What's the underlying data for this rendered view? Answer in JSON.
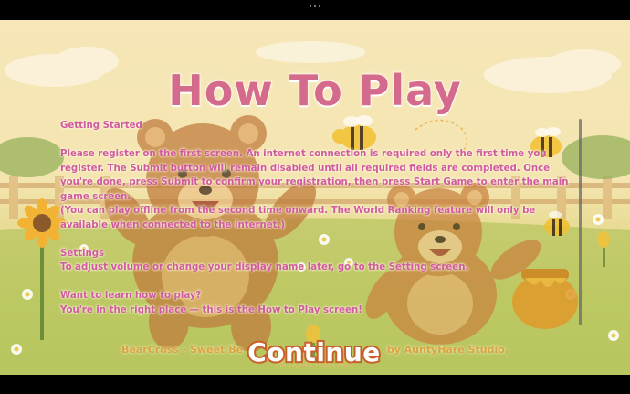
{
  "window": {
    "top_bar_menu_icon": "more-dots-icon"
  },
  "screen": {
    "title": "How To Play"
  },
  "instructions": {
    "getting_started_heading": "Getting Started",
    "getting_started_body": "Please register on the first screen. An internet connection is required only the first time you register. The Submit button will remain disabled until all required fields are completed. Once you're done, press Submit to confirm your registration, then press Start Game to enter the main game screen.",
    "offline_note": "(You can play offline from the second time onward. The World Ranking feature will only be available when connected to the internet.)",
    "settings_heading": "Settings",
    "settings_body": "To adjust volume or change your display name later, go to the Setting screen.",
    "learn_heading": "Want to learn how to play?",
    "learn_body": "You're in the right place — this is the How to Play screen!"
  },
  "footer": {
    "credit_left": "BearCross - Sweet Be",
    "credit_right": "by AuntyHare Studio.",
    "rights": "All rights reserved."
  },
  "buttons": {
    "continue_label": "Continue"
  },
  "colors": {
    "title": "#d46a8c",
    "body_text": "#d05a9e",
    "continue_outline": "#c8602a",
    "footer_text": "#d9a441"
  }
}
